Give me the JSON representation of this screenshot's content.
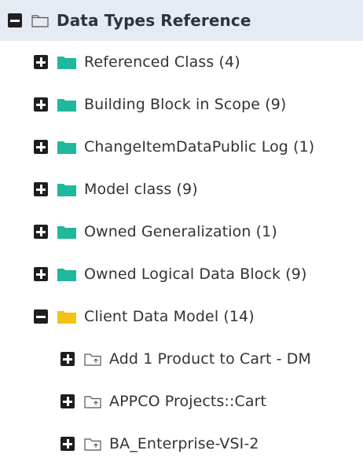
{
  "tree": {
    "root": {
      "label": "Data Types Reference",
      "expanded": true
    },
    "items": [
      {
        "label": "Referenced Class (4)",
        "expanded": false,
        "folder_color": "#1fb89a"
      },
      {
        "label": "Building Block in Scope (9)",
        "expanded": false,
        "folder_color": "#1fb89a"
      },
      {
        "label": "ChangeItemDataPublic Log (1)",
        "expanded": false,
        "folder_color": "#1fb89a"
      },
      {
        "label": "Model class (9)",
        "expanded": false,
        "folder_color": "#1fb89a"
      },
      {
        "label": "Owned Generalization (1)",
        "expanded": false,
        "folder_color": "#1fb89a"
      },
      {
        "label": "Owned Logical Data Block (9)",
        "expanded": false,
        "folder_color": "#1fb89a"
      },
      {
        "label": "Client Data Model (14)",
        "expanded": true,
        "folder_color": "#f2c218",
        "children": [
          {
            "label": "Add 1 Product to Cart - DM",
            "expanded": false
          },
          {
            "label": "APPCO Projects::Cart",
            "expanded": false
          },
          {
            "label": "BA_Enterprise-VSI-2",
            "expanded": false
          }
        ]
      }
    ]
  },
  "icons": {
    "expand": "plus-square-icon",
    "collapse": "minus-square-icon",
    "category_folder": "folder-filled-icon",
    "object": "object-folder-outline-icon",
    "root": "folder-outline-icon"
  },
  "colors": {
    "root_background": "#e6eaf2",
    "toggle": "#1f1f1f",
    "text": "#333333",
    "category_folder": "#1fb89a",
    "open_folder": "#f2c218"
  }
}
